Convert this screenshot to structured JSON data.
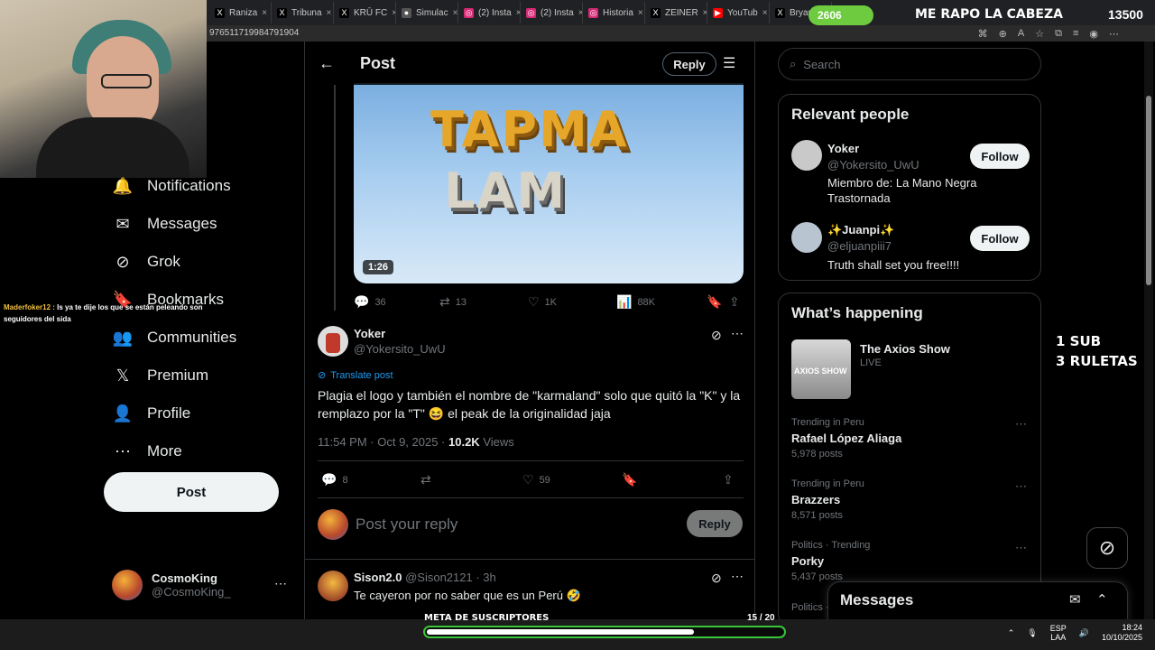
{
  "browser": {
    "tabs": [
      {
        "label": "Raniza",
        "icon": "x-icon"
      },
      {
        "label": "Tribuna",
        "icon": "x-icon"
      },
      {
        "label": "KRŪ FC",
        "icon": "x-icon"
      },
      {
        "label": "Simulac",
        "icon": "app-icon"
      },
      {
        "label": "(2) Insta",
        "icon": "instagram-icon"
      },
      {
        "label": "(2) Insta",
        "icon": "instagram-icon"
      },
      {
        "label": "Historia",
        "icon": "instagram-icon"
      },
      {
        "label": "ZEINER",
        "icon": "x-icon"
      },
      {
        "label": "YouTub",
        "icon": "youtube-icon"
      },
      {
        "label": "Bryan",
        "icon": "x-icon"
      }
    ],
    "address": "976511719984791904"
  },
  "stream_chat": {
    "user": "Maderfoker12 :",
    "message": " Is ya te dije los que se están peleando son seguidores del sida"
  },
  "nav": {
    "items": [
      {
        "label": "Notifications",
        "icon": "bell-icon",
        "glyph": "🔔"
      },
      {
        "label": "Messages",
        "icon": "mail-icon",
        "glyph": "✉"
      },
      {
        "label": "Grok",
        "icon": "grok-icon",
        "glyph": "⊘"
      },
      {
        "label": "Bookmarks",
        "icon": "bookmark-icon",
        "glyph": "🔖"
      },
      {
        "label": "Communities",
        "icon": "people-icon",
        "glyph": "👥"
      },
      {
        "label": "Premium",
        "icon": "x-logo-icon",
        "glyph": "𝕏"
      },
      {
        "label": "Profile",
        "icon": "person-icon",
        "glyph": "👤"
      },
      {
        "label": "More",
        "icon": "more-circle-icon",
        "glyph": "⋯"
      }
    ],
    "post_button": "Post"
  },
  "account": {
    "name": "CosmoKing",
    "handle": "@CosmoKing_"
  },
  "header": {
    "title": "Post",
    "reply_button": "Reply"
  },
  "media": {
    "logo_line1": "TAPMA",
    "logo_line2": "LAM",
    "duration": "1:26"
  },
  "parent_actions": {
    "replies": "36",
    "reposts": "13",
    "likes": "1K",
    "views": "88K"
  },
  "tweet": {
    "name": "Yoker",
    "handle": "@Yokersito_UwU",
    "translate": "Translate post",
    "text": "Plagia el logo y también el nombre de \"karmaland\" solo que quitó la \"K\" y la remplazo por la \"T\" 😆 el peak de la originalidad jaja",
    "time": "11:54 PM · Oct 9, 2025 · ",
    "views_count": "10.2K",
    "views_label": " Views",
    "replies": "8",
    "likes": "59"
  },
  "composer": {
    "placeholder": "Post your reply",
    "reply_button": "Reply"
  },
  "reply": {
    "name": "Sison2.0",
    "meta": " @Sison2121 · 3h",
    "text": "Te cayeron por no saber que es un Perú 🤣"
  },
  "right": {
    "search_placeholder": "Search",
    "relevant_title": "Relevant people",
    "people": [
      {
        "name": "Yoker",
        "handle": "@Yokersito_UwU",
        "bio": "Miembro de: La Mano Negra Trastornada",
        "button": "Follow"
      },
      {
        "name": "✨Juanpi✨",
        "handle": "@eljuanpiii7",
        "bio": "Truth shall set you free!!!!",
        "button": "Follow"
      }
    ],
    "happening_title": "What’s happening",
    "live": {
      "name": "The Axios Show",
      "status": "LIVE",
      "thumb_text": "AXIOS SHOW"
    },
    "trends": [
      {
        "category": "Trending in Peru",
        "name": "Rafael López Aliaga",
        "count": "5,978 posts"
      },
      {
        "category": "Trending in Peru",
        "name": "Brazzers",
        "count": "8,571 posts"
      },
      {
        "category": "Politics · Trending",
        "name": "Porky",
        "count": "5,437 posts"
      },
      {
        "category": "Politics · Trending",
        "name": "",
        "count": ""
      }
    ]
  },
  "messages_dock": {
    "title": "Messages"
  },
  "overlay": {
    "top_counter": "2606",
    "top_title": "ME RAPO LA CABEZA",
    "top_number": "13500",
    "sub_line1": "1 SUB",
    "sub_line2": "3 RULETAS",
    "goal_label": "META DE SUSCRIPTORES",
    "goal_count": "15  / 20",
    "goal_progress": 0.75
  },
  "taskbar": {
    "lang": "ESP",
    "lang2": "LAA",
    "time": "18:24",
    "date": "10/10/2025"
  }
}
